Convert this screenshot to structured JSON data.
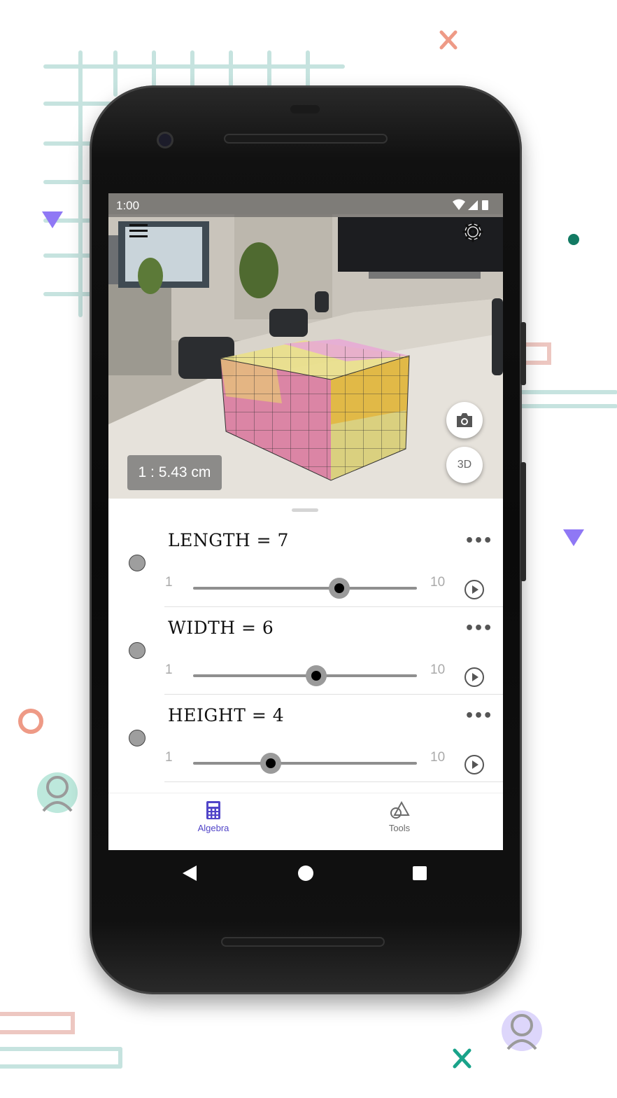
{
  "status_bar": {
    "time": "1:00"
  },
  "ar_view": {
    "scale": "1 : 5.43 cm",
    "view_3d_label": "3D"
  },
  "sliders": [
    {
      "label": "LENGTH = 7",
      "min": "1",
      "max": "10",
      "value": 7
    },
    {
      "label": "WIDTH = 6",
      "min": "1",
      "max": "10",
      "value": 6
    },
    {
      "label": "HEIGHT = 4",
      "min": "1",
      "max": "10",
      "value": 4
    }
  ],
  "more_glyph": "•••",
  "bottom_nav": {
    "algebra": "Algebra",
    "tools": "Tools",
    "active": "algebra",
    "active_color": "#5145c8",
    "inactive_color": "#6b6b6b"
  },
  "icons": [
    "menu-icon",
    "settings-icon",
    "camera-icon",
    "wifi-icon",
    "signal-icon",
    "battery-icon",
    "calculator-icon",
    "tools-shapes-icon",
    "back-icon",
    "home-icon",
    "recents-icon"
  ]
}
